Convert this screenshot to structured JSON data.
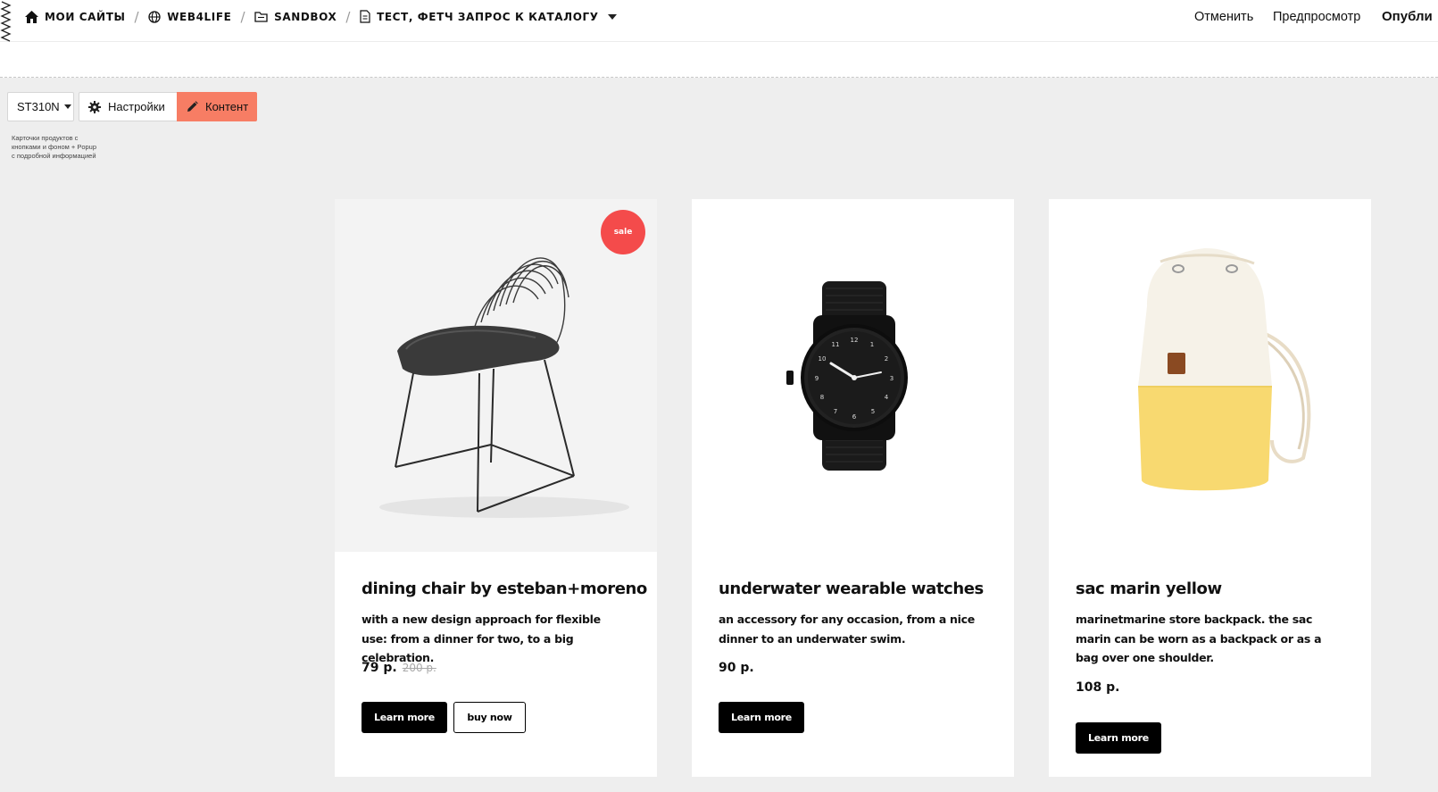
{
  "topbar": {
    "breadcrumbs": [
      {
        "label": "МОИ САЙТЫ",
        "icon": "home-icon"
      },
      {
        "label": "WEB4LIFE",
        "icon": "globe-icon"
      },
      {
        "label": "SANDBOX",
        "icon": "folder-icon"
      },
      {
        "label": "ТЕСТ, ФЕТЧ ЗАПРОС К КАТАЛОГУ",
        "icon": "page-icon"
      }
    ],
    "separator": "/",
    "cancel_label": "Отменить",
    "preview_label": "Предпросмотр",
    "publish_label": "Опубли"
  },
  "block": {
    "code_label": "ST310N",
    "settings_label": "Настройки",
    "content_label": "Контент",
    "description": "Карточки продуктов с кнопками и фоном + Popup с подробной информацией",
    "content_accent": "#f77d64"
  },
  "cards": [
    {
      "badge": "sale",
      "title": "dining chair by esteban+moreno",
      "description": "with a new design approach for flexible use: from a dinner for two, to a big celebration.",
      "price": "79 р.",
      "old_price": "200 р.",
      "primary_button": "Learn more",
      "secondary_button": "buy now",
      "image": "chair-image"
    },
    {
      "title": "underwater wearable watches",
      "description": "an accessory for any occasion, from a nice dinner to an underwater swim.",
      "price": "90 р.",
      "primary_button": "Learn more",
      "image": "watch-image"
    },
    {
      "title": "sac marin yellow",
      "description": "marinetmarine store backpack. the sac marin can be worn as a backpack or as a bag over one shoulder.",
      "price": "108 р.",
      "primary_button": "Learn more",
      "image": "backpack-image"
    }
  ],
  "colors": {
    "sale_badge": "#f44b4b",
    "button_dark": "#000000",
    "page_bg": "#eeeeee"
  }
}
